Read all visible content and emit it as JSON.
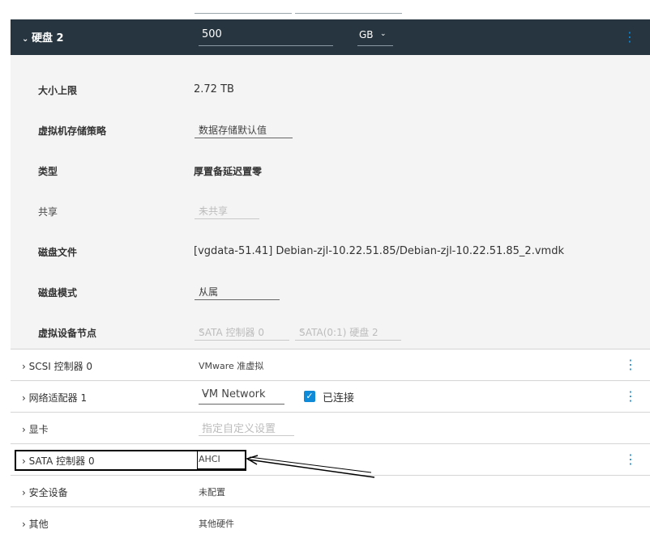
{
  "disk": {
    "title": "硬盘 2",
    "size_value": "500",
    "size_unit": "GB",
    "header_chevron": "chevron-down-icon",
    "details": {
      "max_size_label": "大小上限",
      "max_size_value": "2.72 TB",
      "policy_label": "虚拟机存储策略",
      "policy_value": "数据存储默认值",
      "type_label": "类型",
      "type_value": "厚置备延迟置零",
      "share_label": "共享",
      "share_value": "未共享",
      "file_label": "磁盘文件",
      "file_value": "[vgdata-51.41] Debian-zjl-10.22.51.85/Debian-zjl-10.22.51.85_2.vmdk",
      "mode_label": "磁盘模式",
      "mode_value": "从属",
      "node_label": "虚拟设备节点",
      "node_controller": "SATA 控制器 0",
      "node_slot": "SATA(0:1) 硬盘 2"
    }
  },
  "devices": [
    {
      "label": "SCSI 控制器 0",
      "value": "VMware 准虚拟"
    },
    {
      "label": "网络适配器 1",
      "value": "VM Network",
      "connected_label": "已连接",
      "connected": true
    },
    {
      "label": "显卡",
      "value": "指定自定义设置"
    },
    {
      "label": "SATA 控制器 0",
      "value": "AHCI"
    },
    {
      "label": "安全设备",
      "value": "未配置"
    },
    {
      "label": "其他",
      "value": "其他硬件"
    }
  ],
  "colors": {
    "header_bg": "#26353f",
    "accent": "#0f8ad8",
    "details_bg": "#f4f4f4"
  }
}
